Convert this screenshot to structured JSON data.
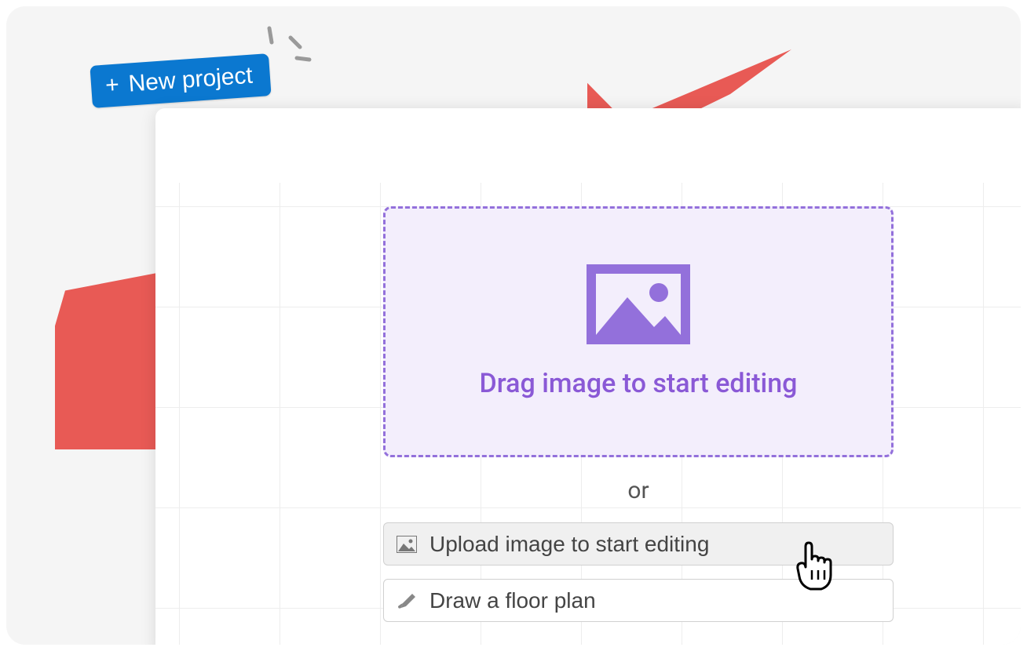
{
  "new_project": {
    "label": "New project"
  },
  "drop_zone": {
    "text": "Drag image to start editing"
  },
  "divider_text": "or",
  "options": {
    "upload": "Upload image to start editing",
    "draw": "Draw a floor plan"
  },
  "colors": {
    "primary_blue": "#0b78d0",
    "purple": "#9370db",
    "purple_text": "#8a59d6",
    "purple_bg": "#f3eefc",
    "red_shape": "#e85a55"
  }
}
